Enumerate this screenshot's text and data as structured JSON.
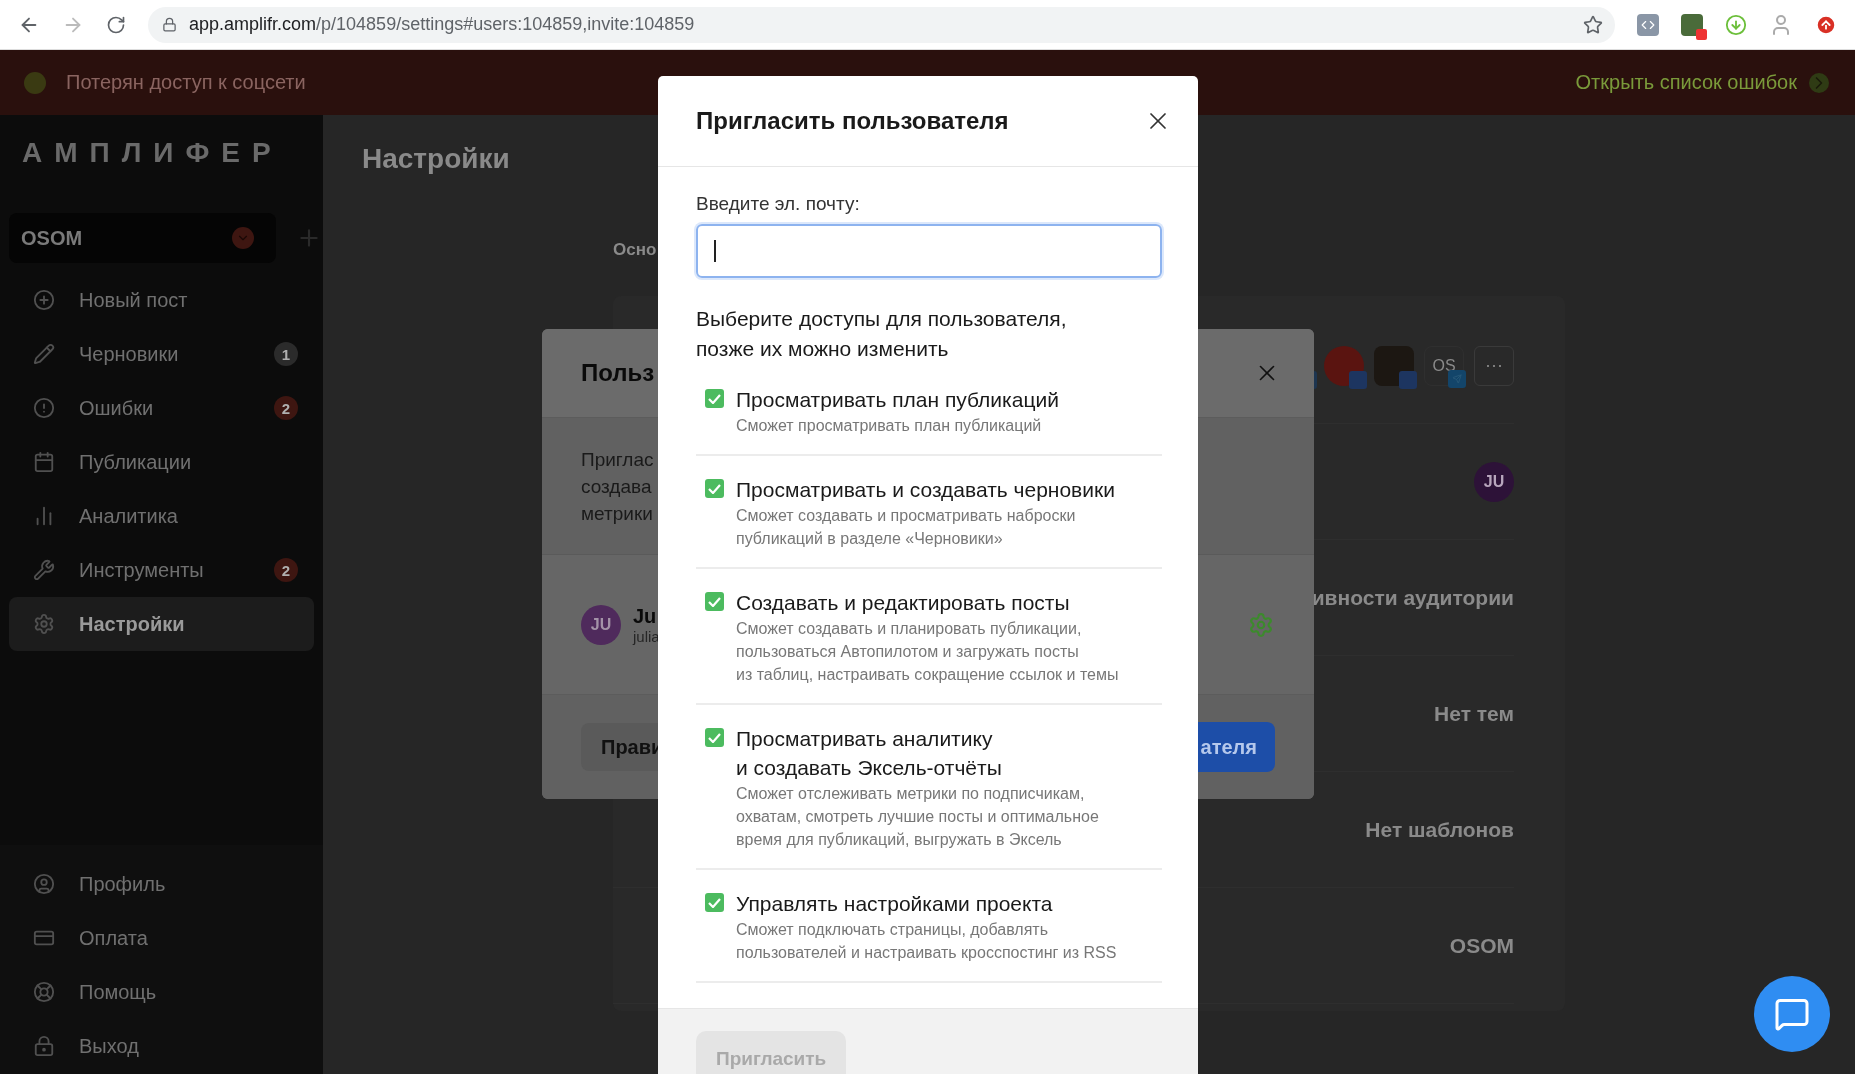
{
  "browser": {
    "url_host": "app.amplifr.com",
    "url_path": "/p/104859/settings#users:104859,invite:104859"
  },
  "alert_banner": {
    "message": "Потерян доступ к соцсети",
    "link": "Открыть список ошибок"
  },
  "sidebar": {
    "logo": "АМПЛИФЕР",
    "project": "OSOM",
    "items": [
      {
        "label": "Новый пост",
        "selected": false
      },
      {
        "label": "Черновики",
        "selected": false,
        "badge": {
          "text": "1",
          "color": "#2b2b2b"
        }
      },
      {
        "label": "Ошибки",
        "selected": false,
        "badge": {
          "text": "2",
          "color": "#3e1611"
        }
      },
      {
        "label": "Публикации",
        "selected": false
      },
      {
        "label": "Аналитика",
        "selected": false
      },
      {
        "label": "Инструменты",
        "selected": false,
        "badge": {
          "text": "2",
          "color": "#3e1611"
        }
      },
      {
        "label": "Настройки",
        "selected": true
      }
    ],
    "bottom_items": [
      {
        "label": "Профиль"
      },
      {
        "label": "Оплата"
      },
      {
        "label": "Помощь"
      },
      {
        "label": "Выход"
      }
    ]
  },
  "page": {
    "title": "Настройки",
    "tab": "Осно",
    "account_initials": "OS",
    "more": "···",
    "avatar": "JU",
    "rows": [
      "ивности аудитории",
      "Нет тем",
      "Нет шаблонов",
      "OSOM"
    ]
  },
  "users_dialog": {
    "title": "Польз",
    "intro_lines": [
      "Приглас",
      "создава",
      "метрики"
    ],
    "user": {
      "initials": "JU",
      "name": "Ju",
      "email": "julia"
    },
    "edit_button": "Прави",
    "add_button": "ателя"
  },
  "invite_dialog": {
    "title": "Пригласить пользователя",
    "email_label": "Введите эл. почту:",
    "email_focused": true,
    "permissions_intro": "Выберите доступы для пользователя,\nпозже их можно изменить",
    "permissions": [
      {
        "title": "Просматривать план публикаций",
        "description": "Сможет просматривать план публикаций",
        "checked": true
      },
      {
        "title": "Просматривать и создавать черновики",
        "description": "Сможет создавать и просматривать наброски\nпубликаций в разделе «Черновики»",
        "checked": true
      },
      {
        "title": "Создавать и редактировать посты",
        "description": "Сможет создавать и планировать публикации,\nпользоваться Автопилотом и загружать посты\nиз таблиц, настраивать сокращение ссылок и темы",
        "checked": true
      },
      {
        "title": "Просматривать аналитику\nи создавать Эксель-отчёты",
        "description": "Сможет отслеживать метрики по подписчикам,\nохватам, смотреть лучшие посты и оптимальное\nвремя для публикаций, выгружать в Эксель",
        "checked": true
      },
      {
        "title": "Управлять настройками проекта",
        "description": "Сможет подключать страницы, добавлять\nпользователей и настраивать кросспостинг из RSS",
        "checked": true
      }
    ],
    "submit": "Пригласить",
    "submit_disabled": true
  }
}
